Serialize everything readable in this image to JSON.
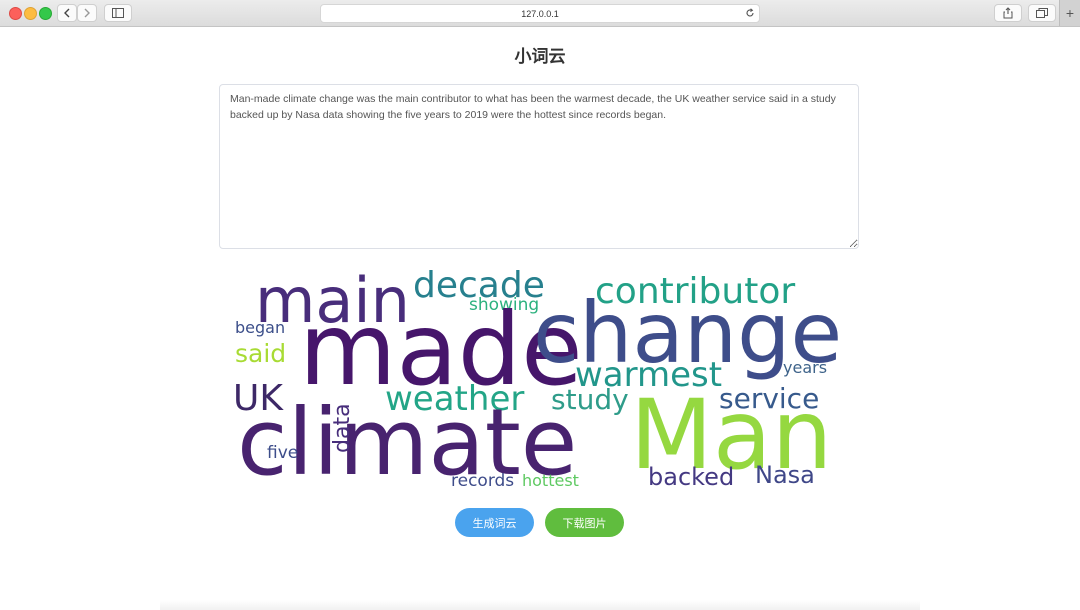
{
  "browser": {
    "url": "127.0.0.1",
    "new_tab_label": "+"
  },
  "page": {
    "title": "小词云",
    "input_text": "Man-made climate change was the main contributor to what has been the warmest decade, the UK weather service said in a study backed up by Nasa data showing the five years to 2019 were the hottest since records began.",
    "generate_button": "生成词云",
    "download_button": "下载图片"
  },
  "word_cloud": {
    "words": [
      {
        "text": "main",
        "color": "#482d7b"
      },
      {
        "text": "decade",
        "color": "#27808e"
      },
      {
        "text": "showing",
        "color": "#2cb17e"
      },
      {
        "text": "contributor",
        "color": "#22a187"
      },
      {
        "text": "made",
        "color": "#46166b"
      },
      {
        "text": "change",
        "color": "#3e4d8a"
      },
      {
        "text": "began",
        "color": "#3c4f8a"
      },
      {
        "text": "said",
        "color": "#a8db34"
      },
      {
        "text": "warmest",
        "color": "#22968b"
      },
      {
        "text": "years",
        "color": "#3e638a"
      },
      {
        "text": "UK",
        "color": "#3d2867"
      },
      {
        "text": "weather",
        "color": "#23a587"
      },
      {
        "text": "study",
        "color": "#2f9c8a"
      },
      {
        "text": "service",
        "color": "#375a8c"
      },
      {
        "text": "climate",
        "color": "#48236f"
      },
      {
        "text": "Man",
        "color": "#95d840"
      },
      {
        "text": "data",
        "color": "#472d7b"
      },
      {
        "text": "five",
        "color": "#3d4d8a"
      },
      {
        "text": "records",
        "color": "#3e4c8a"
      },
      {
        "text": "hottest",
        "color": "#5ec962"
      },
      {
        "text": "backed",
        "color": "#443982"
      },
      {
        "text": "Nasa",
        "color": "#3f4788"
      }
    ]
  }
}
